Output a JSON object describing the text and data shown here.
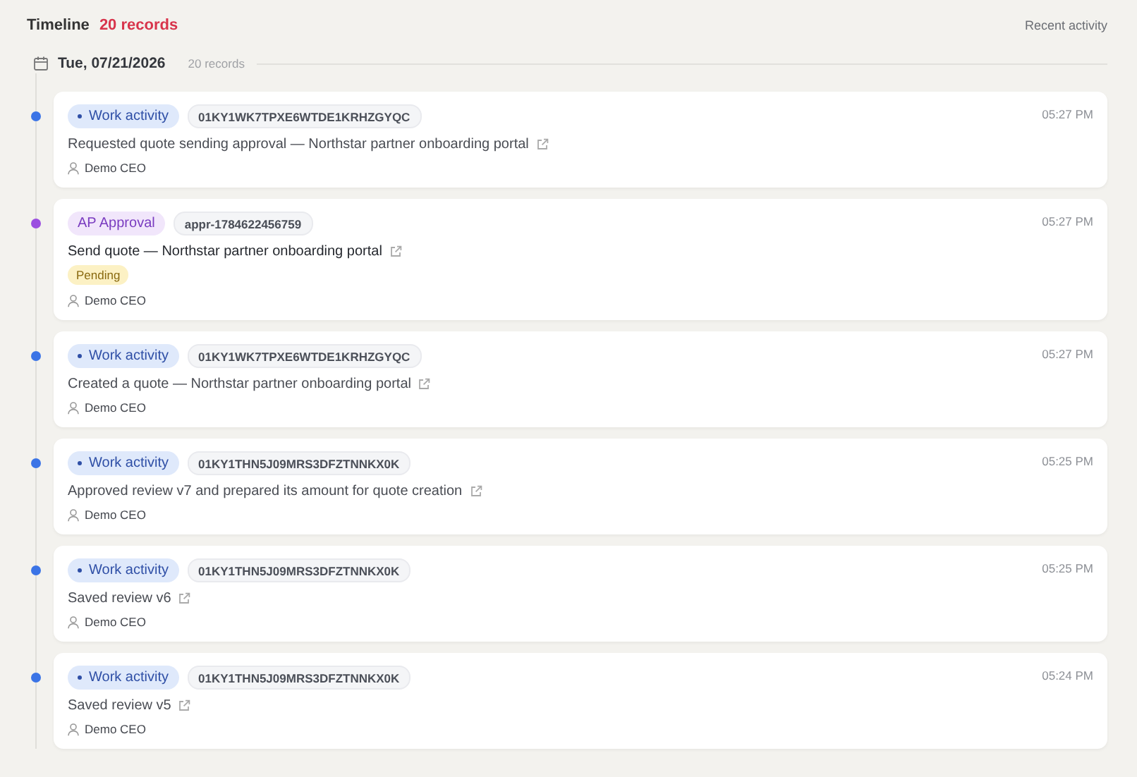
{
  "header": {
    "title": "Timeline",
    "count": "20 records",
    "link": "Recent activity"
  },
  "date_group": {
    "date": "Tue, 07/21/2026",
    "count": "20 records"
  },
  "entries": [
    {
      "kind": "work",
      "color": "#3b74e6",
      "tag": "Work activity",
      "ref": "01KY1WK7TPXE6WTDE1KRHZGYQC",
      "description": "Requested quote sending approval — Northstar partner onboarding portal",
      "author": "Demo CEO",
      "time": "05:27 PM"
    },
    {
      "kind": "approval",
      "color": "#9b4fe0",
      "tag": "AP Approval",
      "ref": "appr-1784622456759",
      "description": "Send quote — Northstar partner onboarding portal",
      "status": "Pending",
      "author": "Demo CEO",
      "time": "05:27 PM"
    },
    {
      "kind": "work",
      "color": "#3b74e6",
      "tag": "Work activity",
      "ref": "01KY1WK7TPXE6WTDE1KRHZGYQC",
      "description": "Created a quote — Northstar partner onboarding portal",
      "author": "Demo CEO",
      "time": "05:27 PM"
    },
    {
      "kind": "work",
      "color": "#3b74e6",
      "tag": "Work activity",
      "ref": "01KY1THN5J09MRS3DFZTNNKX0K",
      "description": "Approved review v7 and prepared its amount for quote creation",
      "author": "Demo CEO",
      "time": "05:25 PM"
    },
    {
      "kind": "work",
      "color": "#3b74e6",
      "tag": "Work activity",
      "ref": "01KY1THN5J09MRS3DFZTNNKX0K",
      "description": "Saved review v6",
      "author": "Demo CEO",
      "time": "05:25 PM"
    },
    {
      "kind": "work",
      "color": "#3b74e6",
      "tag": "Work activity",
      "ref": "01KY1THN5J09MRS3DFZTNNKX0K",
      "description": "Saved review v5",
      "author": "Demo CEO",
      "time": "05:24 PM"
    }
  ]
}
